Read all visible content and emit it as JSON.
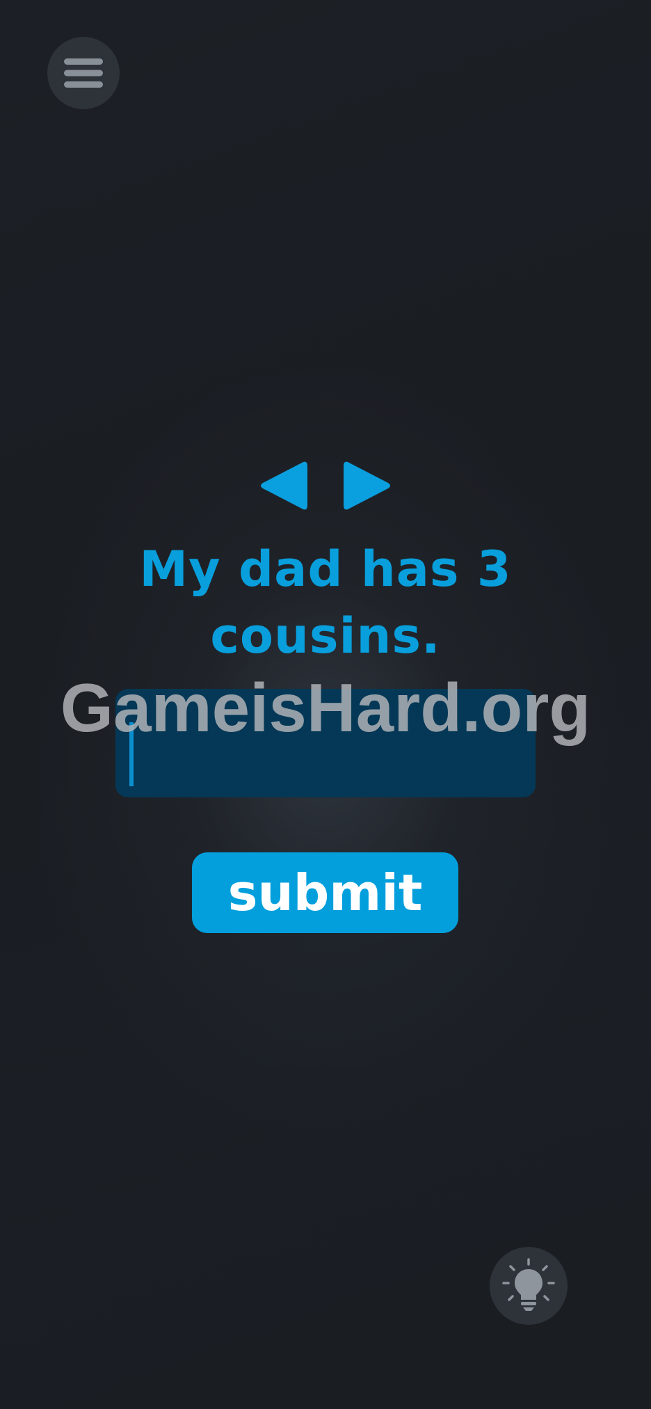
{
  "question": {
    "text": "My dad has 3 cousins."
  },
  "answer": {
    "value": "",
    "placeholder": ""
  },
  "submit": {
    "label": "submit"
  },
  "watermark": {
    "text": "GameisHard.org"
  },
  "icons": {
    "menu": "menu-icon",
    "prev": "previous-arrow-icon",
    "next": "next-arrow-icon",
    "hint": "lightbulb-icon"
  },
  "colors": {
    "accent": "#029fdc",
    "input_bg": "#043856",
    "background": "#1b1e23",
    "round_button": "#2e3339"
  }
}
